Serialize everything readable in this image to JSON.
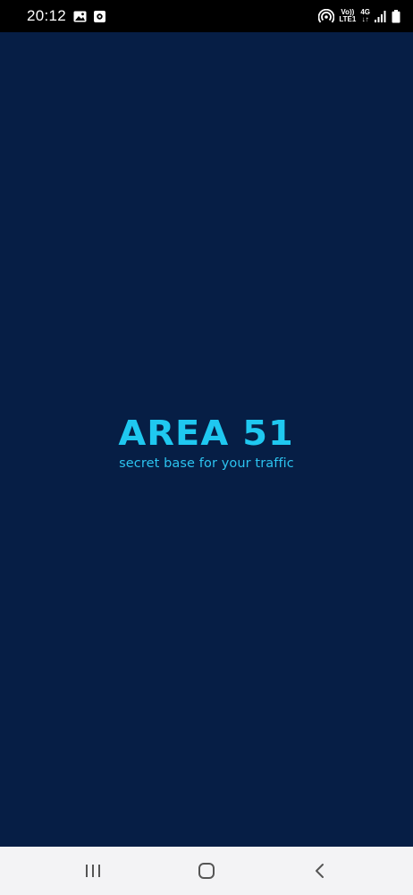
{
  "status_bar": {
    "time": "20:12",
    "volte_top": "Vo))",
    "volte_bottom": "LTE1",
    "network_top": "4G",
    "network_bottom": "↓↑",
    "icons": [
      "gallery-icon",
      "app-notification-icon",
      "hotspot-icon",
      "signal-icon",
      "battery-icon"
    ]
  },
  "splash": {
    "logo": "AREA 51",
    "tagline": "secret base for your traffic"
  },
  "nav_bar": {
    "icons": [
      "recent-apps-icon",
      "home-icon",
      "back-icon"
    ]
  },
  "colors": {
    "background": "#061e45",
    "accent": "#1fc8f0",
    "status_bar": "#000000",
    "nav_bar": "#f3f3f5"
  }
}
